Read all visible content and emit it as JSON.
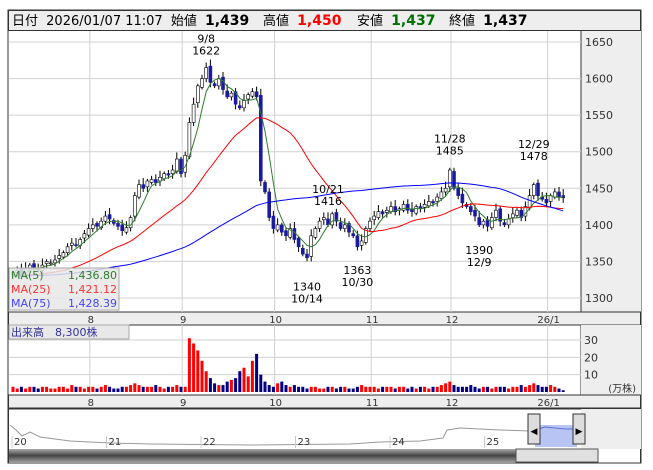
{
  "header": {
    "date_label": "日付",
    "date_value": "2026/01/07 11:07",
    "open_label": "始値",
    "open_value": "1,439",
    "high_label": "高値",
    "high_value": "1,450",
    "low_label": "安値",
    "low_value": "1,437",
    "close_label": "終値",
    "close_value": "1,437"
  },
  "legend": {
    "ma5_label": "MA(5)",
    "ma5_value": "1,436.80",
    "ma25_label": "MA(25)",
    "ma25_value": "1,421.12",
    "ma75_label": "MA(75)",
    "ma75_value": "1,428.39"
  },
  "volume_label": "出来高　8,300株",
  "volume_unit": "(万株)",
  "navigator_years": [
    "20",
    "21",
    "22",
    "23",
    "24",
    "25"
  ],
  "colors": {
    "up": "#ff0000",
    "down": "#000080",
    "ma5": "#2e7d2e",
    "ma25": "#ff0000",
    "ma75": "#0000ff"
  },
  "annotations": [
    {
      "date": "9/8",
      "price": "1622",
      "day": 46,
      "pos": "above"
    },
    {
      "date": "10/14",
      "price": "1340",
      "day": 70,
      "pos": "below"
    },
    {
      "date": "10/21",
      "price": "1416",
      "day": 75,
      "pos": "above"
    },
    {
      "date": "10/30",
      "price": "1363",
      "day": 82,
      "pos": "below"
    },
    {
      "date": "11/28",
      "price": "1485",
      "day": 104,
      "pos": "above"
    },
    {
      "date": "12/9",
      "price": "1390",
      "day": 111,
      "pos": "below"
    },
    {
      "date": "12/29",
      "price": "1478",
      "day": 124,
      "pos": "above"
    }
  ],
  "chart_data": {
    "type": "candlestick",
    "price_ticks": [
      1650,
      1600,
      1550,
      1500,
      1450,
      1400,
      1350,
      1300
    ],
    "ylim": [
      1280,
      1665
    ],
    "month_labels": [
      "8",
      "9",
      "10",
      "11",
      "12",
      "26/1"
    ],
    "month_start_days": [
      19,
      41,
      63,
      86,
      105,
      128
    ],
    "volume_ticks": [
      30,
      20,
      10
    ],
    "volume_ylim": [
      0,
      33
    ],
    "closes": [
      1335,
      1338,
      1332,
      1340,
      1345,
      1342,
      1338,
      1345,
      1350,
      1348,
      1352,
      1358,
      1362,
      1370,
      1375,
      1372,
      1380,
      1388,
      1395,
      1400,
      1398,
      1405,
      1412,
      1408,
      1402,
      1398,
      1392,
      1396,
      1410,
      1440,
      1455,
      1450,
      1460,
      1462,
      1458,
      1465,
      1470,
      1468,
      1475,
      1490,
      1470,
      1495,
      1540,
      1565,
      1590,
      1600,
      1615,
      1595,
      1590,
      1600,
      1585,
      1575,
      1580,
      1565,
      1560,
      1570,
      1578,
      1582,
      1575,
      1460,
      1445,
      1410,
      1395,
      1400,
      1390,
      1385,
      1395,
      1380,
      1370,
      1360,
      1355,
      1385,
      1395,
      1405,
      1410,
      1400,
      1415,
      1405,
      1395,
      1400,
      1390,
      1385,
      1370,
      1378,
      1395,
      1405,
      1412,
      1418,
      1415,
      1420,
      1425,
      1418,
      1422,
      1428,
      1420,
      1418,
      1425,
      1422,
      1428,
      1432,
      1430,
      1438,
      1445,
      1450,
      1475,
      1450,
      1440,
      1430,
      1425,
      1418,
      1412,
      1400,
      1405,
      1398,
      1410,
      1420,
      1405,
      1400,
      1408,
      1415,
      1420,
      1410,
      1425,
      1440,
      1455,
      1440,
      1435,
      1430,
      1440,
      1445,
      1438,
      1437
    ],
    "volumes": [
      3,
      2,
      3,
      2,
      3,
      3,
      2,
      3,
      3,
      2,
      2,
      3,
      3,
      2,
      4,
      3,
      3,
      2,
      3,
      3,
      2,
      3,
      4,
      3,
      2,
      2,
      3,
      3,
      4,
      5,
      4,
      3,
      3,
      3,
      4,
      3,
      2,
      3,
      3,
      4,
      3,
      3,
      31,
      28,
      24,
      18,
      12,
      8,
      5,
      4,
      4,
      6,
      7,
      8,
      12,
      14,
      9,
      18,
      22,
      10,
      6,
      4,
      3,
      5,
      6,
      4,
      3,
      4,
      3,
      3,
      2,
      3,
      3,
      2,
      2,
      3,
      3,
      2,
      3,
      3,
      2,
      2,
      3,
      4,
      3,
      3,
      3,
      2,
      3,
      3,
      3,
      2,
      3,
      3,
      2,
      3,
      2,
      3,
      3,
      2,
      3,
      3,
      4,
      5,
      6,
      4,
      3,
      3,
      3,
      4,
      3,
      2,
      3,
      3,
      2,
      3,
      3,
      3,
      2,
      3,
      3,
      4,
      3,
      4,
      5,
      4,
      3,
      3,
      4,
      3,
      2,
      1
    ]
  }
}
